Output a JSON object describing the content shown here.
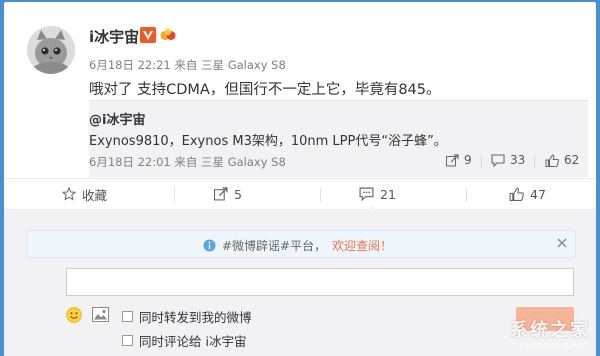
{
  "post": {
    "username": "i冰宇宙",
    "meta": "6月18日 22:21 来自 三星 Galaxy S8",
    "text": "哦对了 支持CDMA，但国行不一定上它，毕竟有845。"
  },
  "quote": {
    "username": "@i冰宇宙",
    "text": "Exynos9810，Exynos M3架构，10nm LPP代号“浴子蜂”。",
    "meta": "6月18日 22:01 来自 三星 Galaxy S8",
    "share_count": "9",
    "comment_count": "33",
    "like_count": "62"
  },
  "actions": {
    "favorite_label": "收藏",
    "share_count": "5",
    "comment_count": "21",
    "like_count": "47"
  },
  "notice": {
    "tag": "#微博辟谣#平台，",
    "link": "欢迎查阅！"
  },
  "composer": {
    "option_repost": "同时转发到我的微博",
    "option_comment": "同时评论给 i冰宇宙"
  },
  "watermark": {
    "main": "系统之家",
    "sub": "XITONGZHIJIA.NET"
  },
  "colors": {
    "background": "#4a90d0",
    "accent": "#eb7350",
    "vip": "#f05a28"
  }
}
